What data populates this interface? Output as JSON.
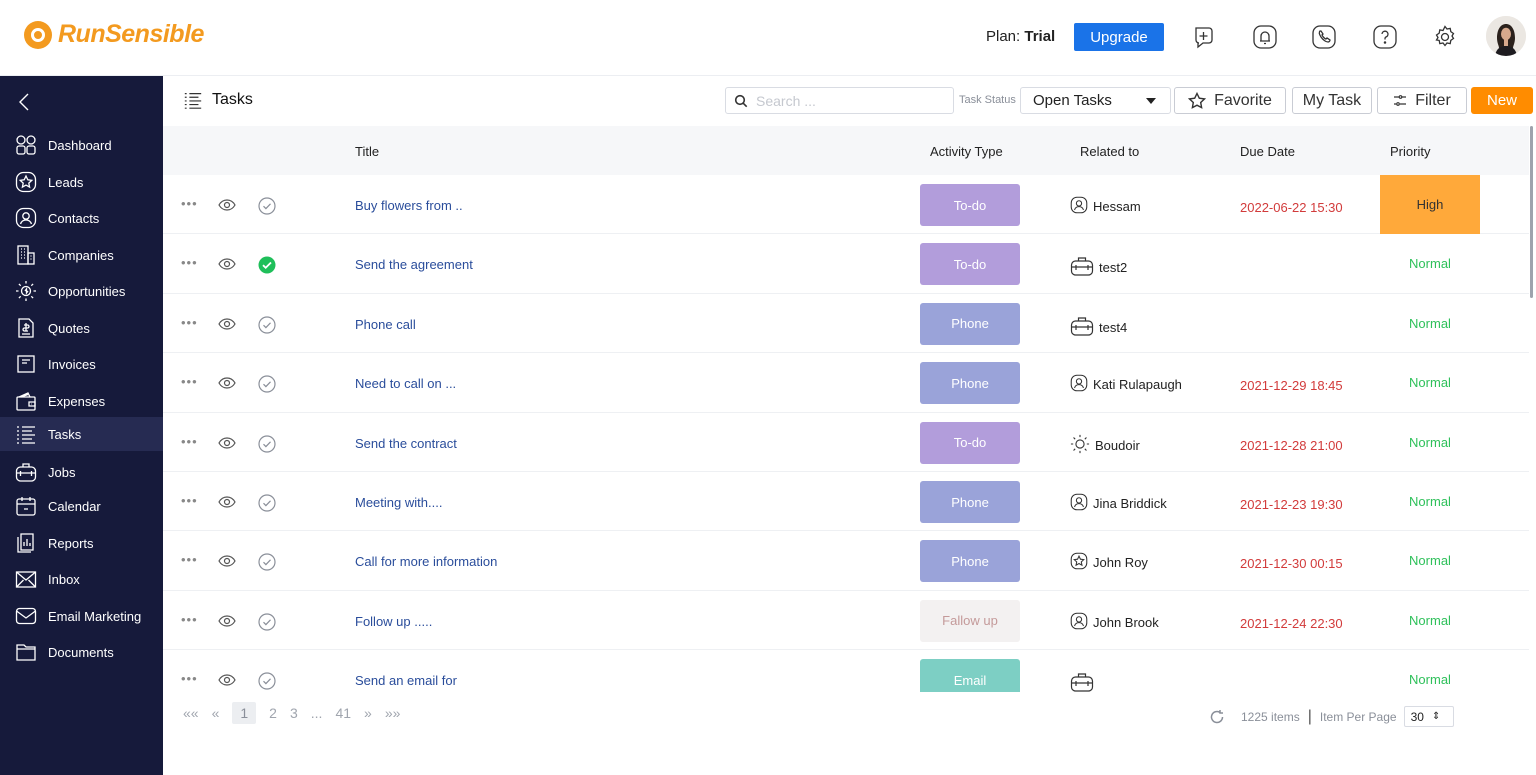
{
  "brand": {
    "name": "RunSensible",
    "color": "#f39a1f"
  },
  "header": {
    "plan_label": "Plan:",
    "plan_value": "Trial",
    "upgrade_label": "Upgrade",
    "icons": [
      "add-task-icon",
      "notification-bell-icon",
      "phone-icon",
      "help-icon",
      "settings-gear-icon"
    ]
  },
  "sidebar": {
    "items": [
      {
        "label": "Dashboard",
        "icon": "dashboard-icon"
      },
      {
        "label": "Leads",
        "icon": "star-icon"
      },
      {
        "label": "Contacts",
        "icon": "contact-icon"
      },
      {
        "label": "Companies",
        "icon": "building-icon"
      },
      {
        "label": "Opportunities",
        "icon": "lightbulb-icon"
      },
      {
        "label": "Quotes",
        "icon": "quote-icon"
      },
      {
        "label": "Invoices",
        "icon": "invoice-icon"
      },
      {
        "label": "Expenses",
        "icon": "wallet-icon"
      },
      {
        "label": "Tasks",
        "icon": "task-list-icon",
        "active": true
      },
      {
        "label": "Jobs",
        "icon": "briefcase-icon"
      },
      {
        "label": "Calendar",
        "icon": "calendar-icon"
      },
      {
        "label": "Reports",
        "icon": "report-icon"
      },
      {
        "label": "Inbox",
        "icon": "inbox-icon"
      },
      {
        "label": "Email Marketing",
        "icon": "email-icon"
      },
      {
        "label": "Documents",
        "icon": "folder-icon"
      }
    ]
  },
  "toolbar": {
    "page_title": "Tasks",
    "search_placeholder": "Search ...",
    "status_label": "Task Status",
    "status_value": "Open Tasks",
    "favorite_label": "Favorite",
    "mytask_label": "My Task",
    "filter_label": "Filter",
    "new_label": "New"
  },
  "table": {
    "columns": {
      "title": "Title",
      "activity": "Activity Type",
      "related": "Related to",
      "due": "Due Date",
      "priority": "Priority"
    },
    "rows": [
      {
        "title": "Buy flowers from ..",
        "activity": "To-do",
        "related": "Hessam",
        "related_icon": "contact-icon",
        "due": "2022-06-22 15:30",
        "priority": "High",
        "done": false
      },
      {
        "title": "Send the agreement",
        "activity": "To-do",
        "related": "test2",
        "related_icon": "briefcase-icon",
        "due": "",
        "priority": "Normal",
        "done": true
      },
      {
        "title": "Phone call",
        "activity": "Phone",
        "related": "test4",
        "related_icon": "briefcase-icon",
        "due": "",
        "priority": "Normal",
        "done": false
      },
      {
        "title": "Need to call on ...",
        "activity": "Phone",
        "related": "Kati Rulapaugh",
        "related_icon": "contact-icon",
        "due": "2021-12-29 18:45",
        "priority": "Normal",
        "done": false
      },
      {
        "title": "Send the contract",
        "activity": "To-do",
        "related": "Boudoir",
        "related_icon": "lightbulb-icon",
        "due": "2021-12-28 21:00",
        "priority": "Normal",
        "done": false
      },
      {
        "title": "Meeting with....",
        "activity": "Phone",
        "related": "Jina Briddick",
        "related_icon": "contact-icon",
        "due": "2021-12-23 19:30",
        "priority": "Normal",
        "done": false
      },
      {
        "title": "Call for more information",
        "activity": "Phone",
        "related": "John Roy",
        "related_icon": "star-icon",
        "due": "2021-12-30 00:15",
        "priority": "Normal",
        "done": false
      },
      {
        "title": "Follow up .....",
        "activity": "Fallow up",
        "related": "John Brook",
        "related_icon": "contact-icon",
        "due": "2021-12-24 22:30",
        "priority": "Normal",
        "done": false
      },
      {
        "title": "Send an email for",
        "activity": "Email",
        "related": "",
        "related_icon": "briefcase-icon",
        "due": "",
        "priority": "Normal",
        "done": false
      }
    ]
  },
  "activity_colors": {
    "To-do": {
      "bg": "#b29ddb",
      "fg": "#ffffff"
    },
    "Phone": {
      "bg": "#9aa3d9",
      "fg": "#ffffff"
    },
    "Fallow up": {
      "bg": "#f3f1f1",
      "fg": "#c49a9a"
    },
    "Email": {
      "bg": "#7dcfc4",
      "fg": "#ffffff"
    }
  },
  "priority_colors": {
    "High": {
      "bg": "#ffa93a",
      "fg": "#333333"
    },
    "Normal": {
      "bg": "transparent",
      "fg": "#2ec05a"
    }
  },
  "pagination": {
    "first": "««",
    "prev": "«",
    "pages": [
      "1",
      "2",
      "3",
      "...",
      "41"
    ],
    "current": "1",
    "next": "»",
    "last": "»»",
    "total_items": "1225 items",
    "per_page_label": "Item Per Page",
    "per_page_value": "30"
  }
}
